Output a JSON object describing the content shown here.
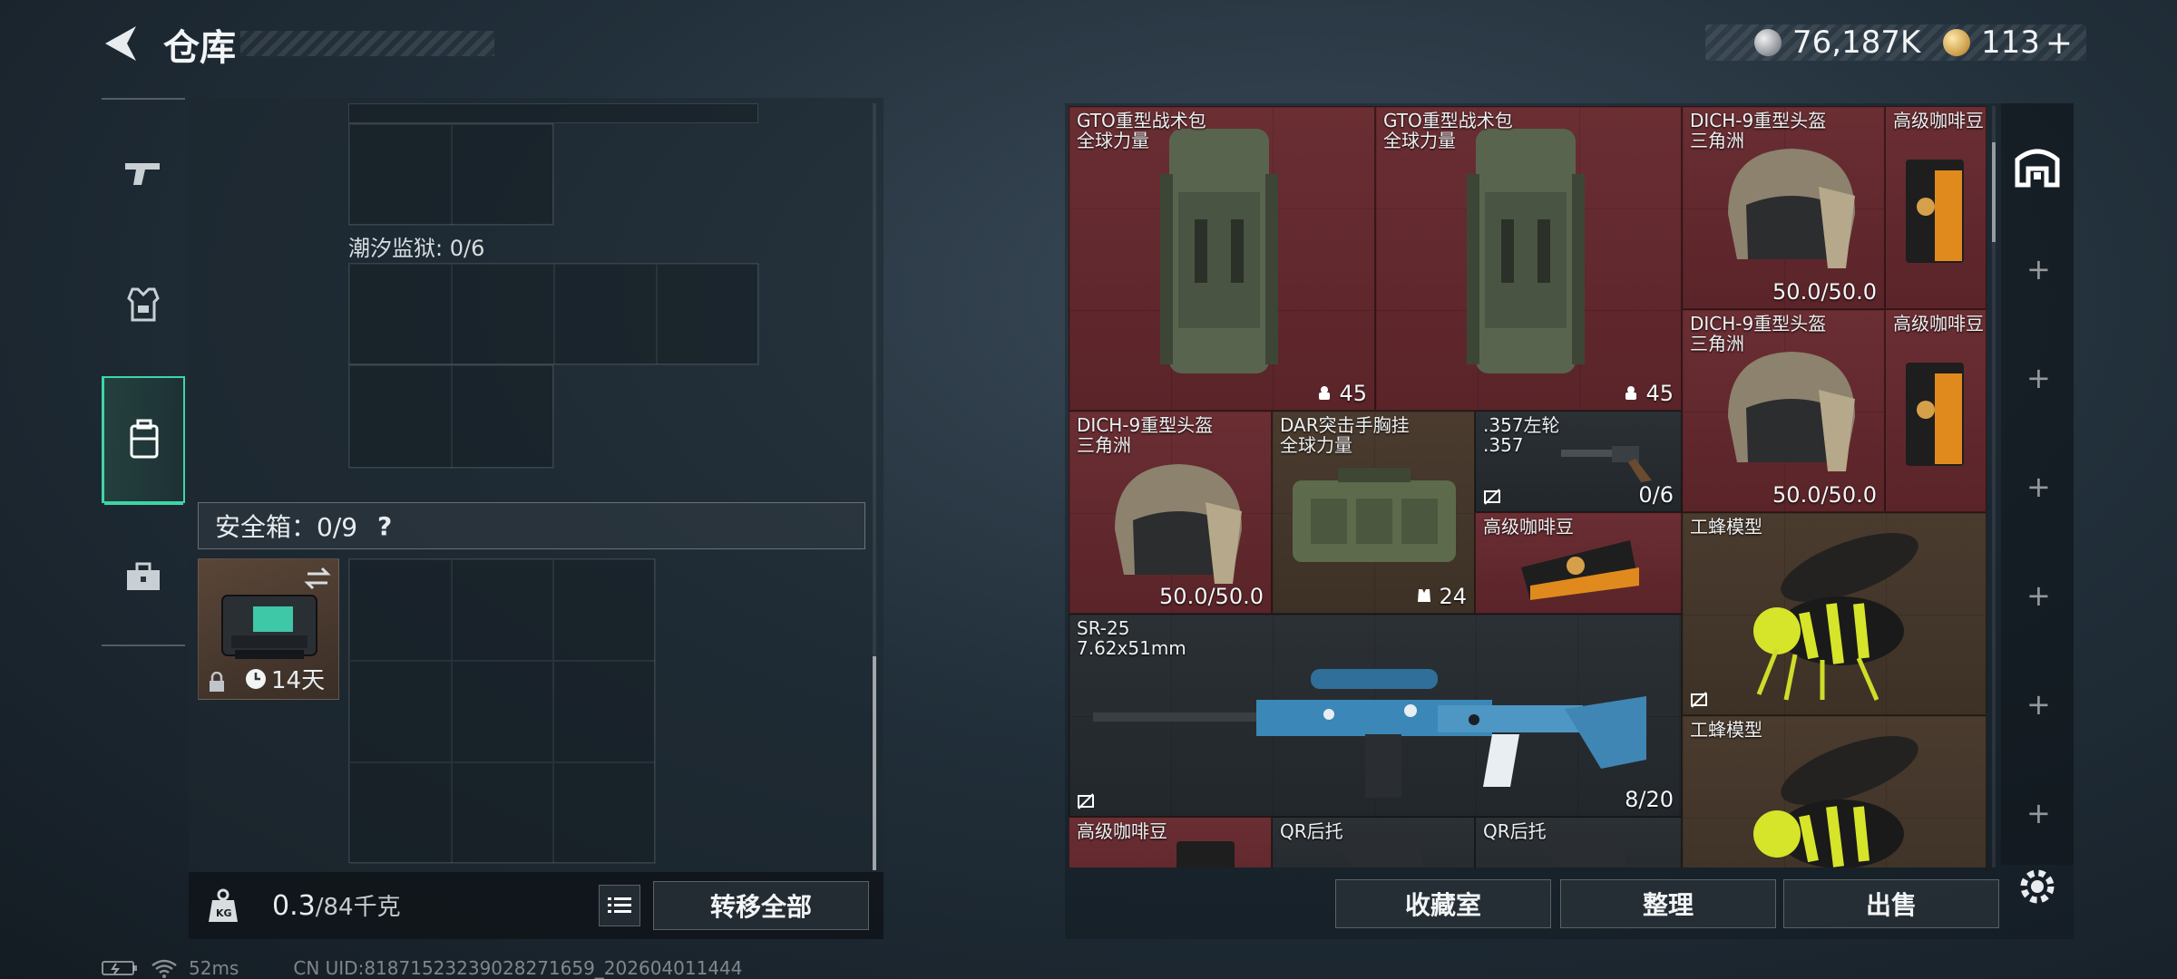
{
  "header": {
    "title": "仓库"
  },
  "currencies": {
    "silver": "76,187K",
    "gold": "113"
  },
  "sidebar": {
    "tabs": [
      "weapons",
      "equipment",
      "storage",
      "toolbox"
    ]
  },
  "storage": {
    "section_label": "潮汐监狱: 0/6",
    "safebox_label": "安全箱：0/9",
    "safebox_help": "?",
    "safebox_timer": "14天",
    "weight_value": "0.3",
    "weight_capacity": "/84千克",
    "transfer_all": "转移全部"
  },
  "inventory": [
    {
      "name": "GTO重型战术包",
      "sub": "全球力量",
      "value": "45"
    },
    {
      "name": "GTO重型战术包",
      "sub": "全球力量",
      "value": "45"
    },
    {
      "name": "DICH-9重型头盔",
      "sub": "三角洲",
      "value": "50.0/50.0"
    },
    {
      "name": "高级咖啡豆",
      "sub": "",
      "value": ""
    },
    {
      "name": "DICH-9重型头盔",
      "sub": "三角洲",
      "value": "50.0/50.0"
    },
    {
      "name": "高级咖啡豆",
      "sub": "",
      "value": ""
    },
    {
      "name": "DICH-9重型头盔",
      "sub": "三角洲",
      "value": "50.0/50.0"
    },
    {
      "name": "DAR突击手胸挂",
      "sub": "全球力量",
      "value": "24"
    },
    {
      "name": ".357左轮",
      "sub": ".357",
      "value": "0/6"
    },
    {
      "name": "高级咖啡豆",
      "sub": "",
      "value": ""
    },
    {
      "name": "工蜂模型",
      "sub": "",
      "value": ""
    },
    {
      "name": "SR-25",
      "sub": "7.62x51mm",
      "value": "8/20"
    },
    {
      "name": "工蜂模型",
      "sub": "",
      "value": ""
    },
    {
      "name": "高级咖啡豆",
      "sub": "",
      "value": ""
    },
    {
      "name": "QR后托",
      "sub": "",
      "value": ""
    },
    {
      "name": "QR后托",
      "sub": "",
      "value": ""
    }
  ],
  "actions": {
    "collection": "收藏室",
    "sort": "整理",
    "sell": "出售"
  },
  "status": {
    "ping": "52ms",
    "uid": "CN UID:81871523239028271659_202604011444"
  }
}
